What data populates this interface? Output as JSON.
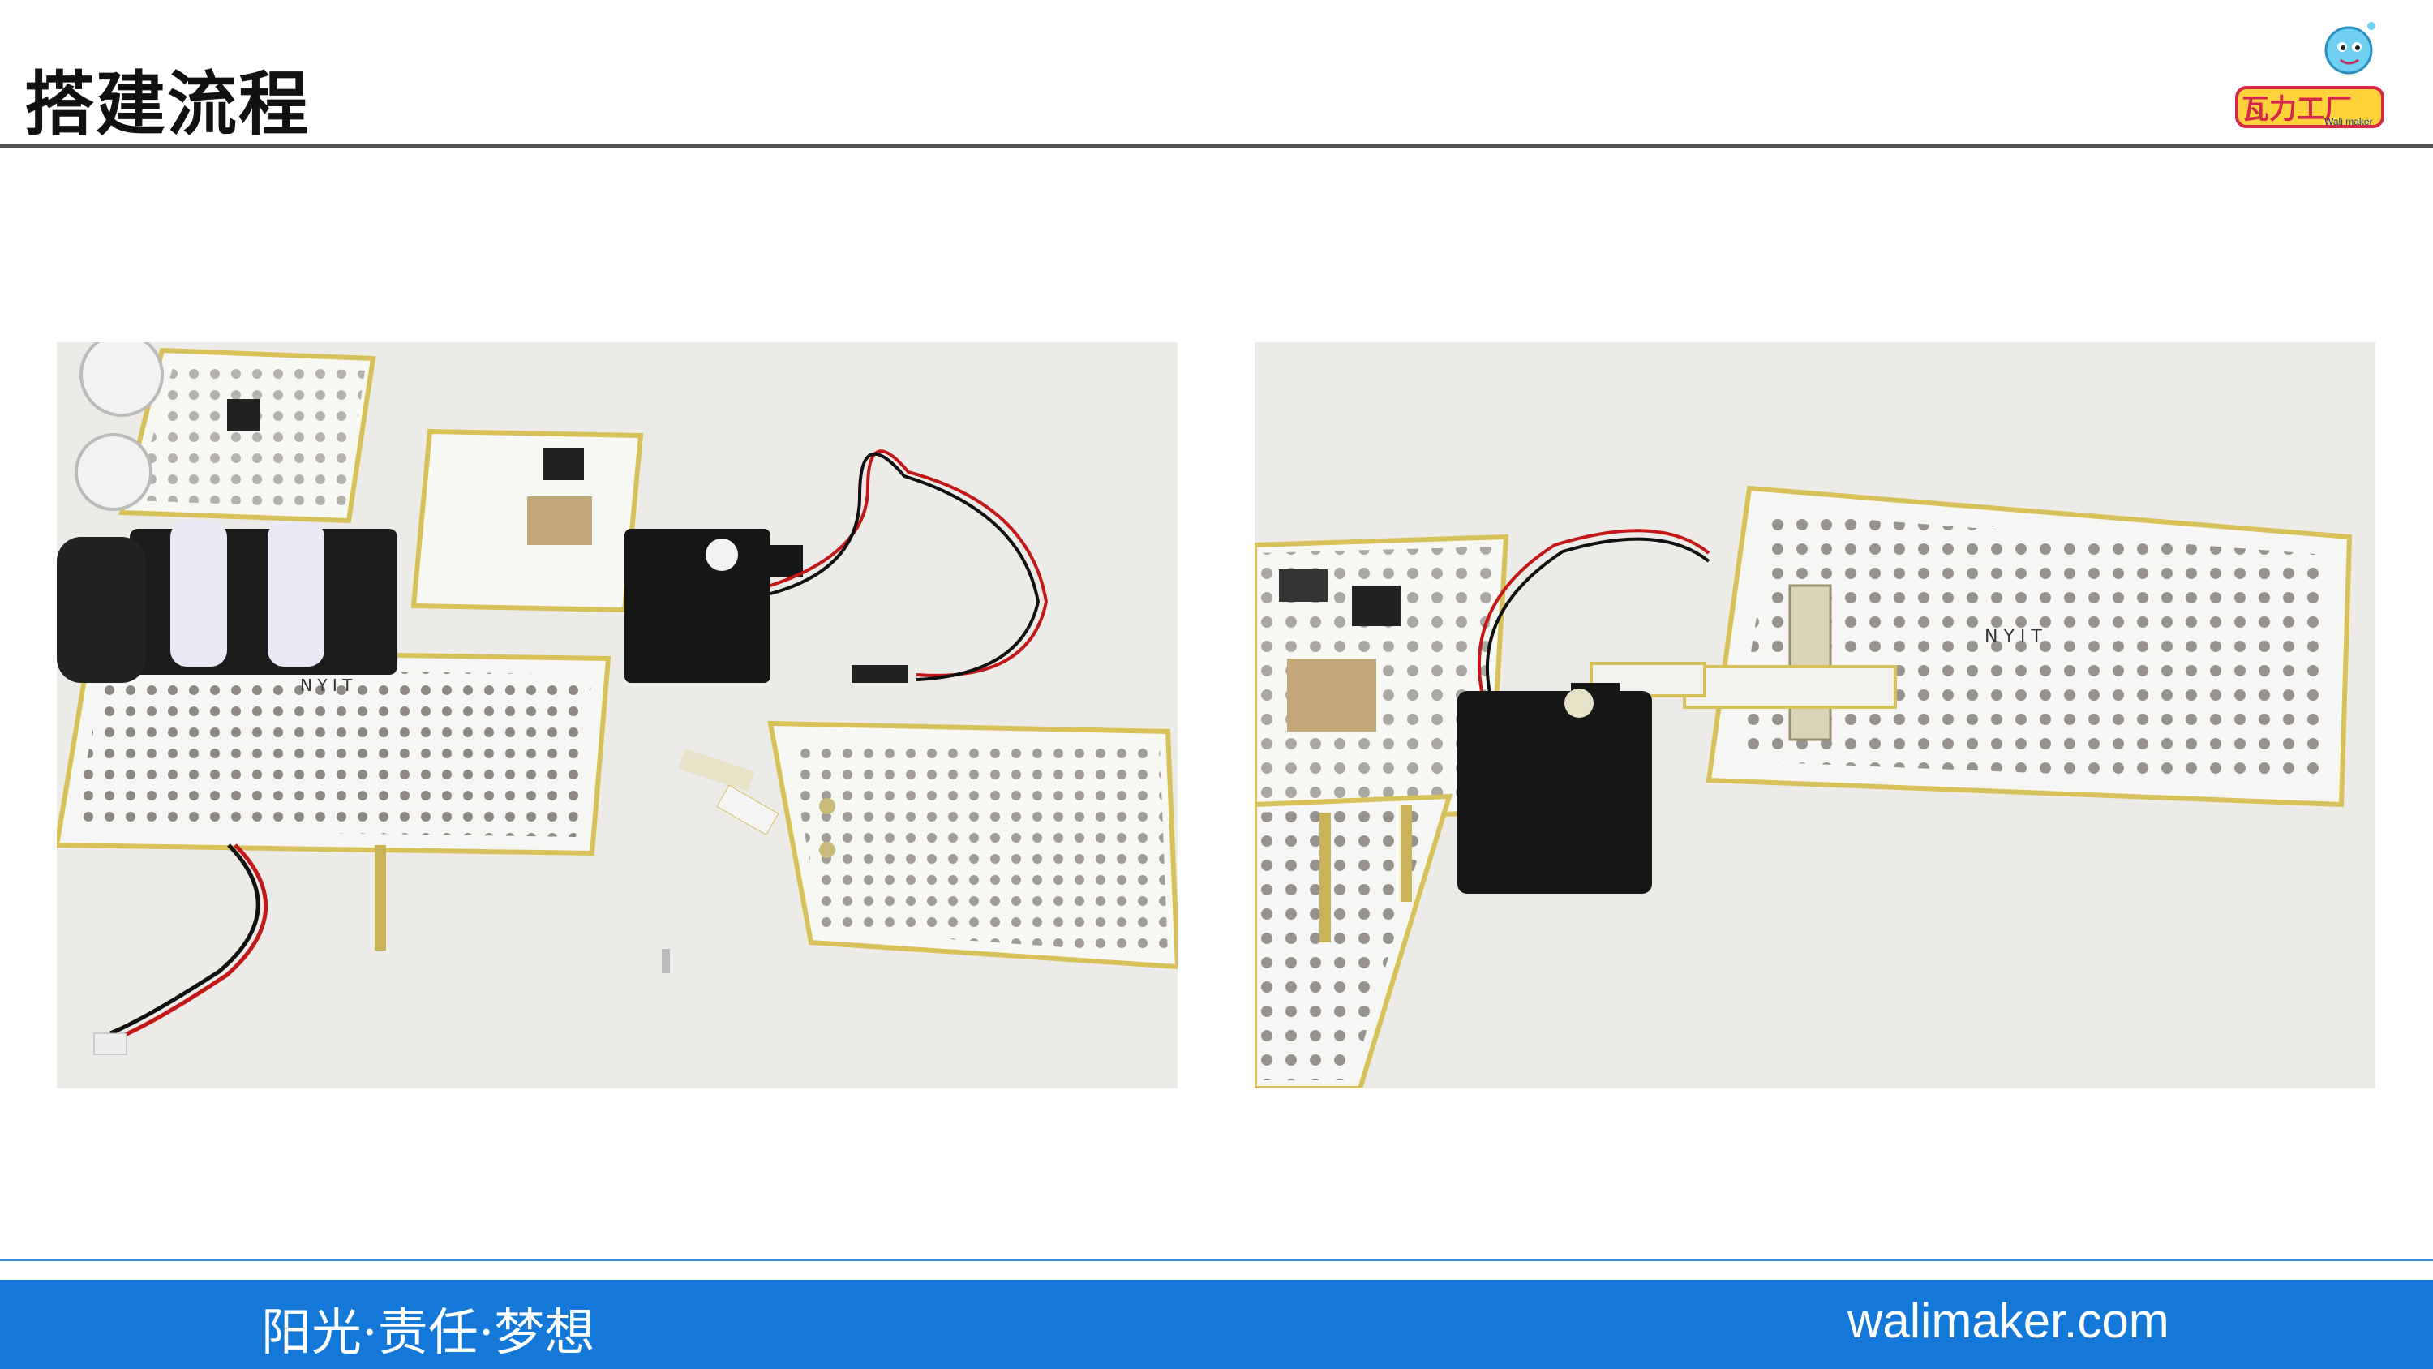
{
  "header": {
    "title": "搭建流程",
    "logo_name": "walimaker-logo",
    "logo_text": "瓦力工厂",
    "logo_subtext": "Wali maker"
  },
  "photos": [
    {
      "name": "build-step-photo-1",
      "board_label": "N Y I T"
    },
    {
      "name": "build-step-photo-2",
      "board_label": "N Y I T"
    }
  ],
  "footer": {
    "slogan": "阳光·责任·梦想",
    "website": "walimaker.com",
    "accent_color": "#1478d8"
  }
}
